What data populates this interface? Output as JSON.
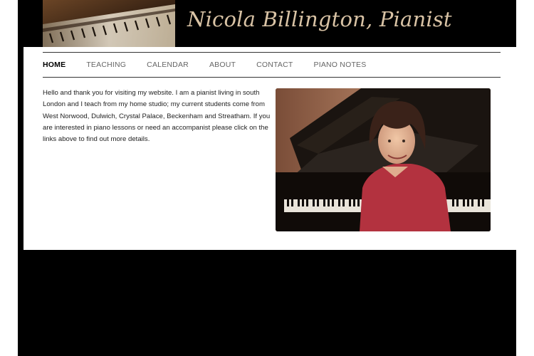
{
  "site": {
    "title": "Nicola Billington, Pianist",
    "colors": {
      "page_background": "#000000",
      "panel_background": "#ffffff",
      "title_color": "#d9c3a5",
      "nav_text": "#666666",
      "nav_active": "#000000"
    }
  },
  "header": {
    "image_icon": "piano-keys-image"
  },
  "nav": {
    "items": [
      {
        "label": "HOME",
        "active": true
      },
      {
        "label": "TEACHING",
        "active": false
      },
      {
        "label": "CALENDAR",
        "active": false
      },
      {
        "label": "ABOUT",
        "active": false
      },
      {
        "label": "CONTACT",
        "active": false
      },
      {
        "label": "PIANO NOTES",
        "active": false
      }
    ]
  },
  "main": {
    "intro_text": "Hello and thank you for visiting my website. I am a pianist living in south London and I teach from my home studio; my current students come from West Norwood, Dulwich, Crystal Palace, Beckenham and Streatham. If you are interested in piano lessons or need an accompanist please click on the links above to find out more details.",
    "photo_icon": "pianist-photo"
  }
}
